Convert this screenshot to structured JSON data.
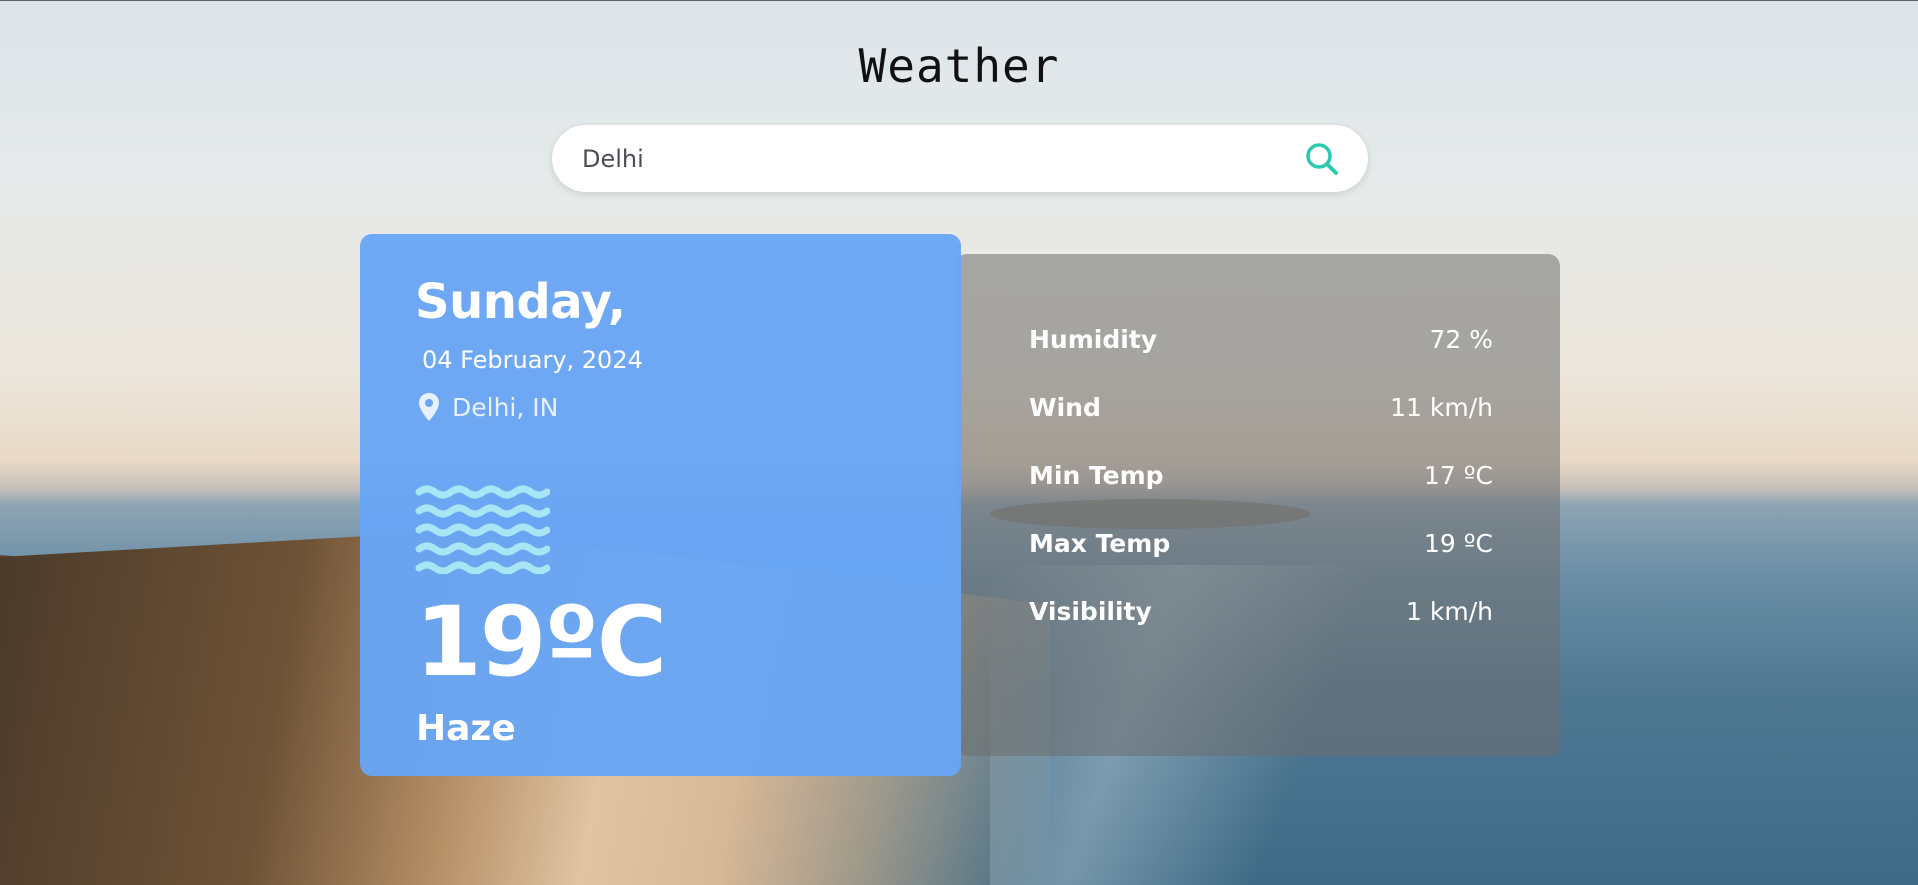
{
  "app": {
    "title": "Weather"
  },
  "search": {
    "value": "Delhi",
    "placeholder": "",
    "icon": "search-icon"
  },
  "current": {
    "day": "Sunday,",
    "date": "04 February, 2024",
    "location": "Delhi, IN",
    "location_icon": "map-pin-icon",
    "condition_icon": "haze-icon",
    "temperature": "19ºC",
    "condition": "Haze"
  },
  "details": {
    "rows": [
      {
        "label": "Humidity",
        "value": "72 %"
      },
      {
        "label": "Wind",
        "value": "11 km/h"
      },
      {
        "label": "Min Temp",
        "value": "17 ºC"
      },
      {
        "label": "Max Temp",
        "value": "19 ºC"
      },
      {
        "label": "Visibility",
        "value": "1 km/h"
      }
    ]
  },
  "colors": {
    "accent": "#2cc9b0",
    "card": "#68a6f5",
    "haze_icon": "#a8e6f5"
  }
}
